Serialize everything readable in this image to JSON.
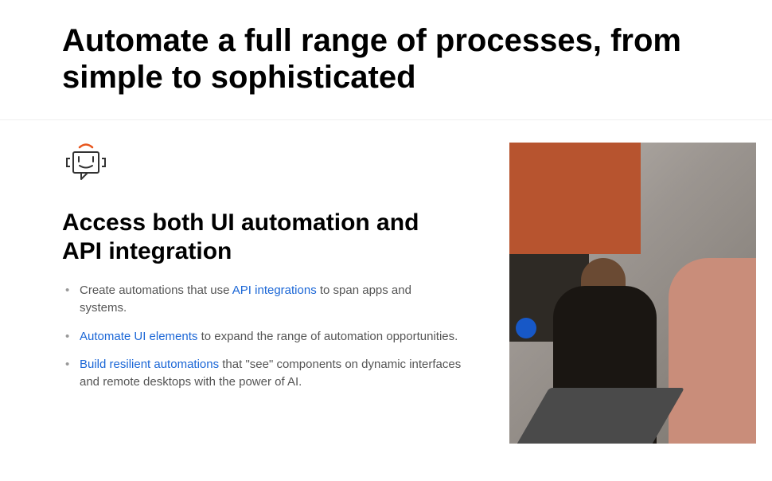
{
  "page_title": "Automate a full range of processes, from simple to sophisticated",
  "section": {
    "heading": "Access both UI automation and API integration",
    "bullets": [
      {
        "pre": "Create automations that use ",
        "link": "API integrations",
        "post": " to span apps and systems."
      },
      {
        "pre": "",
        "link": "Automate UI elements",
        "post": " to expand the range of automation opportunities."
      },
      {
        "pre": "",
        "link": "Build resilient automations",
        "post": " that \"see\" components on dynamic interfaces and remote desktops with the power of AI."
      }
    ]
  }
}
